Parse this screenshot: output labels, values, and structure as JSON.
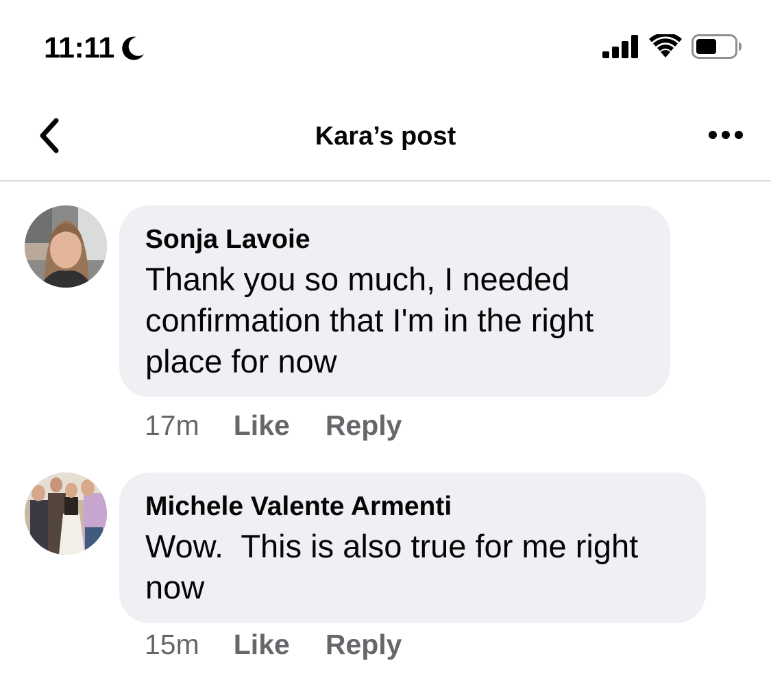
{
  "status_bar": {
    "time": "11:11",
    "moon_icon": "moon-icon",
    "signal_icon": "cellular-signal-icon",
    "wifi_icon": "wifi-icon",
    "battery_icon": "battery-icon",
    "battery_level": 0.55
  },
  "nav": {
    "back_icon": "chevron-left-icon",
    "title": "Kara’s post",
    "more_icon": "more-dots-icon"
  },
  "comments": [
    {
      "author": "Sonja Lavoie",
      "text": "Thank you so much, I needed confirmation that I'm in the right place for now",
      "time": "17m",
      "like_label": "Like",
      "reply_label": "Reply"
    },
    {
      "author": "Michele Valente Armenti",
      "text": "Wow.  This is also true for me right now",
      "time": "15m",
      "like_label": "Like",
      "reply_label": "Reply"
    }
  ],
  "colors": {
    "bubble": "#eff0f4",
    "secondary_text": "#65676b",
    "primary_text": "#050505"
  }
}
